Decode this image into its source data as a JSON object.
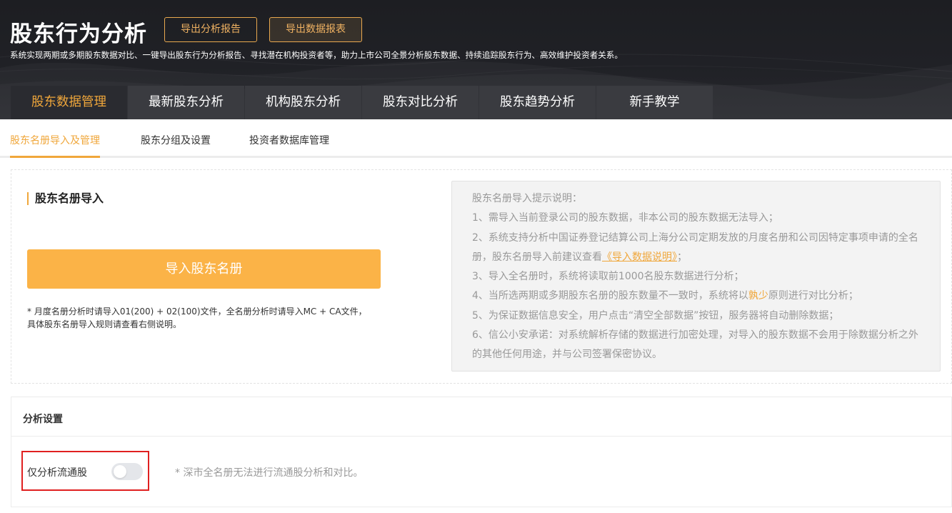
{
  "header": {
    "title": "股东行为分析",
    "export_report_label": "导出分析报告",
    "export_data_label": "导出数据报表",
    "subtitle": "系统实现两期或多期股东数据对比、一键导出股东行为分析报告、寻找潜在机构投资者等，助力上市公司全景分析股东数据、持续追踪股东行为、高效维护投资者关系。"
  },
  "main_tabs": [
    {
      "label": "股东数据管理",
      "active": true
    },
    {
      "label": "最新股东分析",
      "active": false
    },
    {
      "label": "机构股东分析",
      "active": false
    },
    {
      "label": "股东对比分析",
      "active": false
    },
    {
      "label": "股东趋势分析",
      "active": false
    },
    {
      "label": "新手教学",
      "active": false
    }
  ],
  "sub_tabs": [
    {
      "label": "股东名册导入及管理",
      "active": true
    },
    {
      "label": "股东分组及设置",
      "active": false
    },
    {
      "label": "投资者数据库管理",
      "active": false
    }
  ],
  "import_section": {
    "title": "股东名册导入",
    "button_label": "导入股东名册",
    "note": "* 月度名册分析时请导入01(200) + 02(100)文件，全名册分析时请导入MC + CA文件，具体股东名册导入规则请查看右侧说明。"
  },
  "tips": {
    "heading": "股东名册导入提示说明：",
    "item1": "1、需导入当前登录公司的股东数据，非本公司的股东数据无法导入；",
    "item2_prefix": "2、系统支持分析中国证券登记结算公司上海分公司定期发放的月度名册和公司因特定事项申请的全名册，股东名册导入前建议查看",
    "item2_link": "《导入数据说明》",
    "item2_suffix": "；",
    "item3": "3、导入全名册时，系统将读取前1000名股东数据进行分析；",
    "item4_prefix": "4、当所选两期或多期股东名册的股东数量不一致时，系统将以",
    "item4_highlight": "孰少",
    "item4_suffix": "原则进行对比分析；",
    "item5": "5、为保证数据信息安全，用户点击“清空全部数据”按钮，服务器将自动删除数据；",
    "item6": "6、信公小安承诺：对系统解析存储的数据进行加密处理，对导入的股东数据不会用于除数据分析之外的其他任何用途，并与公司签署保密协议。"
  },
  "settings": {
    "title": "分析设置",
    "toggle_label": "仅分析流通股",
    "toggle_on": false,
    "toggle_note": "* 深市全名册无法进行流通股分析和对比。"
  },
  "colors": {
    "accent": "#f0a73b",
    "import_button": "#fbb347",
    "header_bg": "#1f2025",
    "highlight_box": "#e02020"
  }
}
